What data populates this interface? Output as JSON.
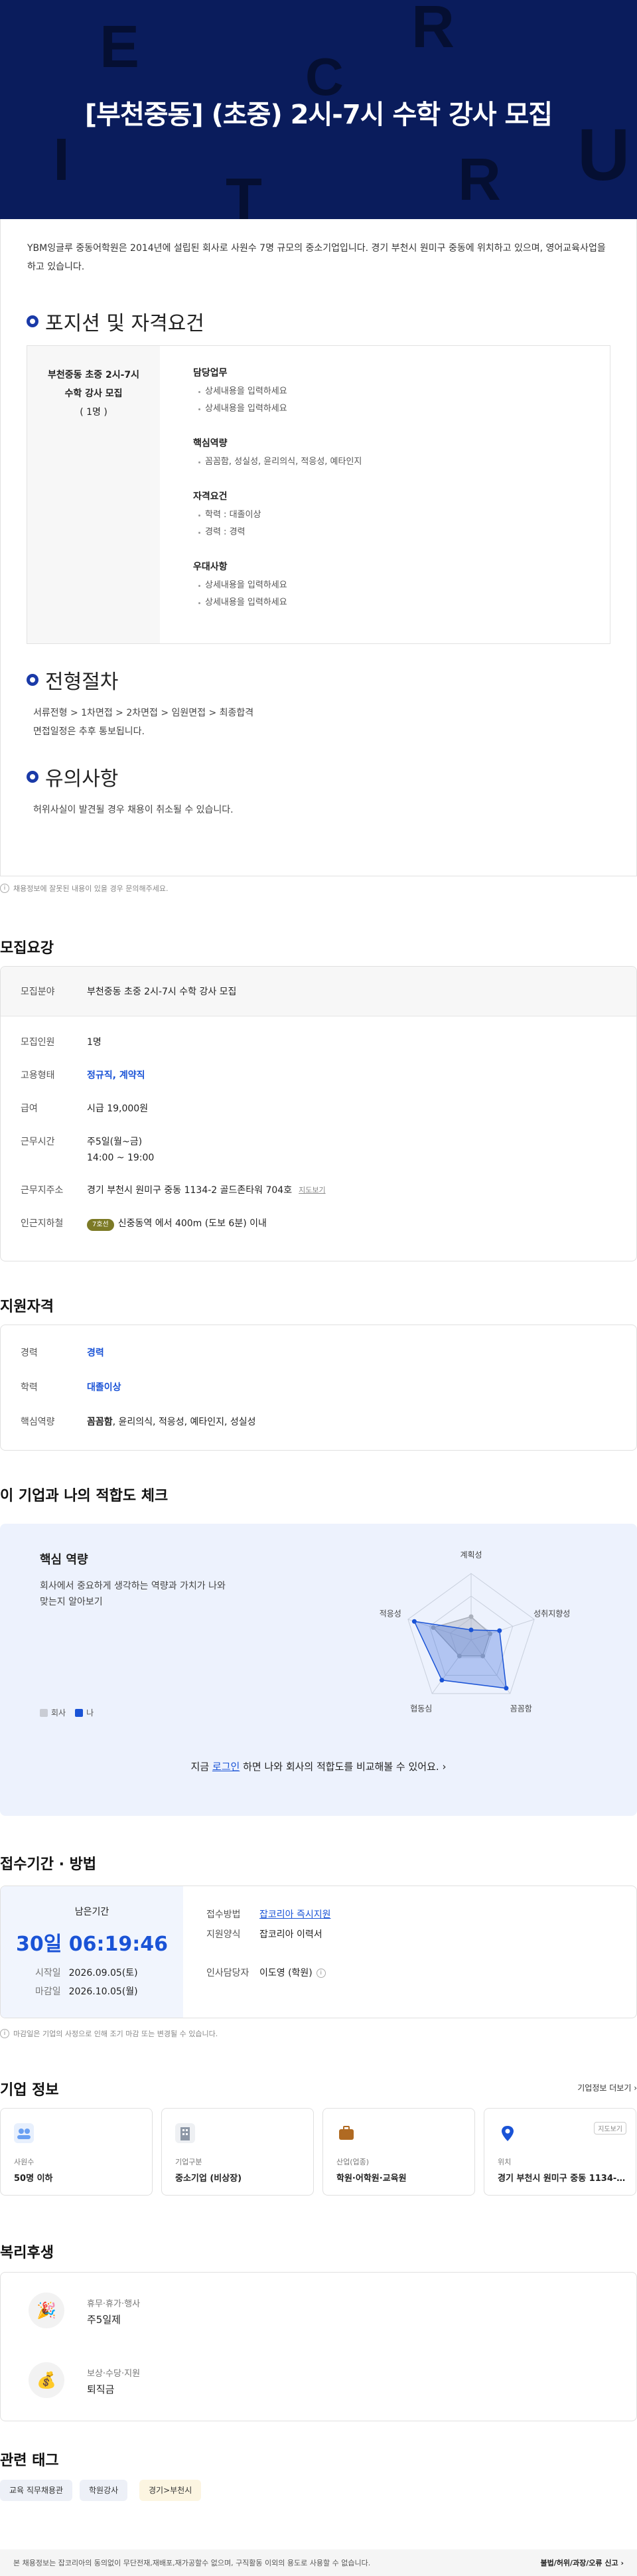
{
  "hero": {
    "title": "[부천중동] (초중) 2시-7시 수학 강사 모집"
  },
  "intro": {
    "text": "YBM잉글루 중동어학원은 2014년에 설립된 회사로 사원수 7명 규모의 중소기업입니다. 경기 부천시 원미구 중동에 위치하고 있으며, 영어교육사업을 하고 있습니다."
  },
  "detail": {
    "position_heading": "포지션 및 자격요건",
    "position_name_1": "부천중동 초중 2시-7시",
    "position_name_2": "수학 강사 모집",
    "position_count": "( 1명 )",
    "groups": [
      {
        "title": "담당업무",
        "items": [
          "상세내용을 입력하세요",
          "상세내용을 입력하세요"
        ]
      },
      {
        "title": "핵심역량",
        "items": [
          "꼼꼼함, 성실성, 윤리의식, 적응성, 예타인지"
        ]
      },
      {
        "title": "자격요건",
        "items": [
          "학력 : 대졸이상",
          "경력 : 경력"
        ]
      },
      {
        "title": "우대사항",
        "items": [
          "상세내용을 입력하세요",
          "상세내용을 입력하세요"
        ]
      }
    ],
    "process_heading": "전형절차",
    "process_items": [
      "서류전형 > 1차면접 > 2차면접 > 임원면접 > 최종합격",
      "면접일정은 추후 통보됩니다."
    ],
    "caution_heading": "유의사항",
    "caution_items": [
      "허위사실이 발견될 경우 채용이 취소될 수 있습니다."
    ]
  },
  "notice_text": "채용정보에 잘못된 내용이 있을 경우 문의해주세요.",
  "summary": {
    "heading": "모집요강",
    "rows": [
      {
        "label": "모집분야",
        "value": "부천중동 초중 2시-7시 수학 강사 모집"
      },
      {
        "label": "모집인원",
        "value": "1명"
      },
      {
        "label": "고용형태",
        "value": "정규직, 계약직"
      },
      {
        "label": "급여",
        "value": "시급 19,000원"
      },
      {
        "label": "근무시간",
        "value_1": "주5일(월~금)",
        "value_2": "14:00 ~ 19:00"
      },
      {
        "label": "근무지주소",
        "value": "경기 부천시 원미구 중동 1134-2 골드존타워 704호",
        "link": "지도보기"
      },
      {
        "label": "인근지하철",
        "line": "7호선",
        "value": "신중동역 에서 400m (도보 6분) 이내"
      }
    ]
  },
  "qualification": {
    "heading": "지원자격",
    "rows": [
      {
        "label": "경력",
        "value": "경력"
      },
      {
        "label": "학력",
        "value": "대졸이상"
      },
      {
        "label": "핵심역량",
        "value_bold": "꼼꼼함",
        "value_rest": ", 윤리의식, 적응성, 예타인지, 성실성"
      }
    ]
  },
  "fit": {
    "heading": "이 기업과 나의 적합도 체크",
    "title": "핵심 역량",
    "desc": "회사에서 중요하게 생각하는 역량과 가치가 나와 맞는지 알아보기",
    "legend_company": "회사",
    "legend_me": "나",
    "cta_pre": "지금 ",
    "cta_link": "로그인",
    "cta_post": " 하면 나와 회사의 적합도를 비교해볼 수 있어요.",
    "colors": {
      "company": "#c9ccd4",
      "me": "#1a53d6"
    }
  },
  "chart_data": {
    "type": "radar",
    "axes": [
      "계획성",
      "성취지향성",
      "꼼꼼함",
      "협동심",
      "적응성"
    ],
    "series": [
      {
        "name": "회사",
        "values": [
          0.35,
          0.3,
          0.3,
          0.3,
          0.6
        ]
      },
      {
        "name": "나",
        "values": [
          0.15,
          0.45,
          0.9,
          0.75,
          0.9
        ]
      }
    ],
    "range": [
      0,
      1
    ]
  },
  "apply": {
    "heading": "접수기간 · 방법",
    "remain_label": "남은기간",
    "remain_value": "30일 06:19:46",
    "start_label": "시작일",
    "start_value": "2026.09.05(토)",
    "end_label": "마감일",
    "end_value": "2026.10.05(월)",
    "method_label": "접수방법",
    "method_value": "잡코리아 즉시지원",
    "form_label": "지원양식",
    "form_value": "잡코리아 이력서",
    "hr_label": "인사담당자",
    "hr_value": "이도영 (학원)",
    "notice": "마감일은 기업의 사정으로 인해 조기 마감 또는 변경될 수 있습니다."
  },
  "company": {
    "heading": "기업 정보",
    "more": "기업정보 더보기",
    "cards": [
      {
        "label": "사원수",
        "value": "50명 이하",
        "color": "#6aa0f2"
      },
      {
        "label": "기업구분",
        "value": "중소기업 (비상장)",
        "color": "#8d97a6"
      },
      {
        "label": "산업(업종)",
        "value": "학원·어학원·교육원",
        "color": "#b06a22"
      },
      {
        "label": "위치",
        "value": "경기 부천시 원미구 중동 1134-2 골드존타워",
        "color": "#1a53d6",
        "link": "지도보기"
      }
    ]
  },
  "welfare": {
    "heading": "복리후생",
    "items": [
      {
        "label": "휴무·휴가·행사",
        "value": "주5일제",
        "icon": "party-popper-icon"
      },
      {
        "label": "보상·수당·지원",
        "value": "퇴직금",
        "icon": "money-bag-icon"
      }
    ]
  },
  "tags": {
    "heading": "관련 태그",
    "items": [
      {
        "label": "교육 직무채용관",
        "color": "#edf0f7"
      },
      {
        "label": "학원강사",
        "color": "#edf0f7"
      },
      {
        "label": "경기>부천시",
        "color": "#fcf5e1"
      }
    ]
  },
  "footer": {
    "text": "본 채용정보는 잡코리아의 동의없이 무단전재,재배포,재가공할수 없으며, 구직활동 이외의 용도로 사용할 수 없습니다.",
    "report": "불법/허위/과장/오류 신고"
  }
}
